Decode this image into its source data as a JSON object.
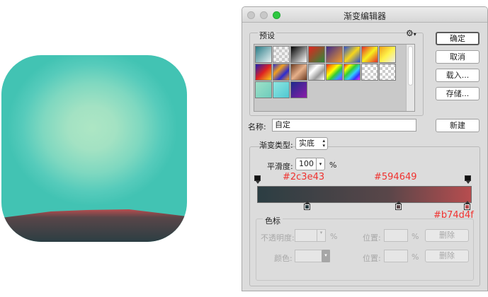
{
  "dialog": {
    "title": "渐变编辑器",
    "presets_label": "预设",
    "preset_menu_icon": "gear-icon",
    "buttons": {
      "ok": "确定",
      "cancel": "取消",
      "load": "载入...",
      "save": "存储...",
      "new": "新建"
    },
    "name_label": "名称:",
    "name_value": "自定",
    "gradient_type_label": "渐变类型:",
    "gradient_type_value": "实底",
    "smoothness_label": "平滑度:",
    "smoothness_value": "100",
    "smoothness_unit": "%",
    "stops_group_label": "色标",
    "opacity_label": "不透明度:",
    "opacity_unit": "%",
    "location_label": "位置:",
    "location_unit": "%",
    "delete_label": "删除",
    "color_label": "颜色:"
  },
  "annotations": {
    "color_start": "#2c3e43",
    "color_mid": "#594649",
    "color_end": "#b74d4f",
    "label_start": "#2c3e43",
    "label_mid": "#594649",
    "label_end": "#b74d4f"
  }
}
